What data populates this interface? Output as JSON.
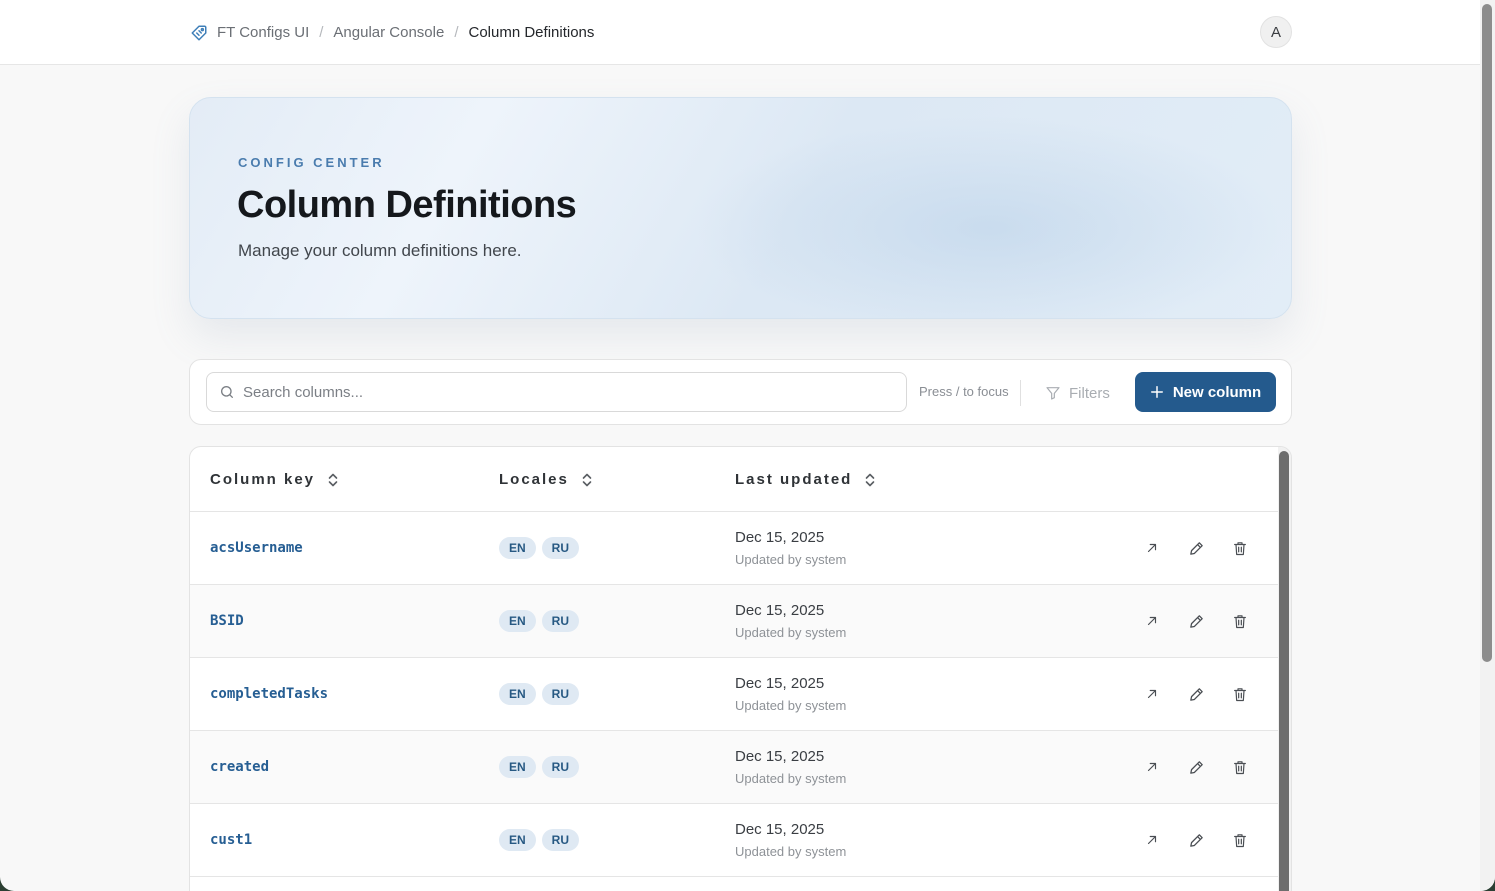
{
  "breadcrumb": {
    "items": [
      "FT Configs UI",
      "Angular Console"
    ],
    "separator": "/",
    "current": "Column Definitions"
  },
  "user": {
    "avatar_initial": "A"
  },
  "hero": {
    "eyebrow": "CONFIG CENTER",
    "title": "Column Definitions",
    "subtitle": "Manage your column definitions here."
  },
  "toolbar": {
    "search_placeholder": "Search columns...",
    "hint": "Press / to focus",
    "filters_label": "Filters",
    "new_button_label": "New column"
  },
  "table": {
    "columns": [
      "Column key",
      "Locales",
      "Last updated"
    ],
    "rows": [
      {
        "key": "acsUsername",
        "locales": [
          "EN",
          "RU"
        ],
        "date": "Dec 15, 2025",
        "updated_by": "Updated by system"
      },
      {
        "key": "BSID",
        "locales": [
          "EN",
          "RU"
        ],
        "date": "Dec 15, 2025",
        "updated_by": "Updated by system"
      },
      {
        "key": "completedTasks",
        "locales": [
          "EN",
          "RU"
        ],
        "date": "Dec 15, 2025",
        "updated_by": "Updated by system"
      },
      {
        "key": "created",
        "locales": [
          "EN",
          "RU"
        ],
        "date": "Dec 15, 2025",
        "updated_by": "Updated by system"
      },
      {
        "key": "cust1",
        "locales": [
          "EN",
          "RU"
        ],
        "date": "Dec 15, 2025",
        "updated_by": "Updated by system"
      }
    ]
  },
  "icons": {
    "logo": "tag-icon",
    "search": "search-icon",
    "filters": "funnel-icon",
    "new": "plus-icon",
    "sort": "sort-icon",
    "open": "arrow-up-right-icon",
    "edit": "pencil-icon",
    "delete": "trash-icon"
  },
  "colors": {
    "accent": "#245a8d",
    "key_text": "#265e93",
    "badge_bg": "#dfe9f3",
    "eyebrow": "#4a7cae"
  }
}
